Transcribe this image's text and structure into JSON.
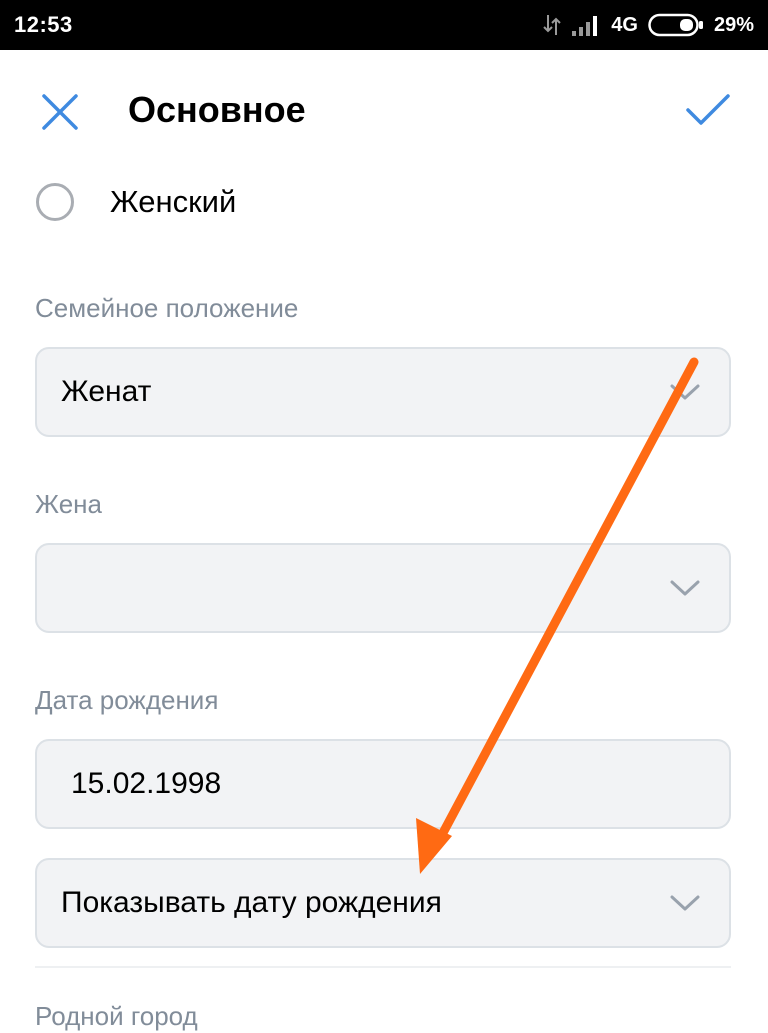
{
  "status_bar": {
    "time": "12:53",
    "network": "4G",
    "battery": "29%"
  },
  "header": {
    "title": "Основное",
    "close_icon": "close-icon",
    "save_icon": "checkmark-icon",
    "accent_color": "#3f8ae0"
  },
  "gender": {
    "option_label": "Женский",
    "selected": false
  },
  "marital_status": {
    "label": "Семейное положение",
    "value": "Женат"
  },
  "spouse": {
    "label": "Жена",
    "value": ""
  },
  "birth_date": {
    "label": "Дата рождения",
    "value": "15.02.1998",
    "visibility_value": "Показывать дату рождения"
  },
  "hometown": {
    "label": "Родной город"
  },
  "annotation": {
    "arrow_color": "#ff6a13"
  }
}
